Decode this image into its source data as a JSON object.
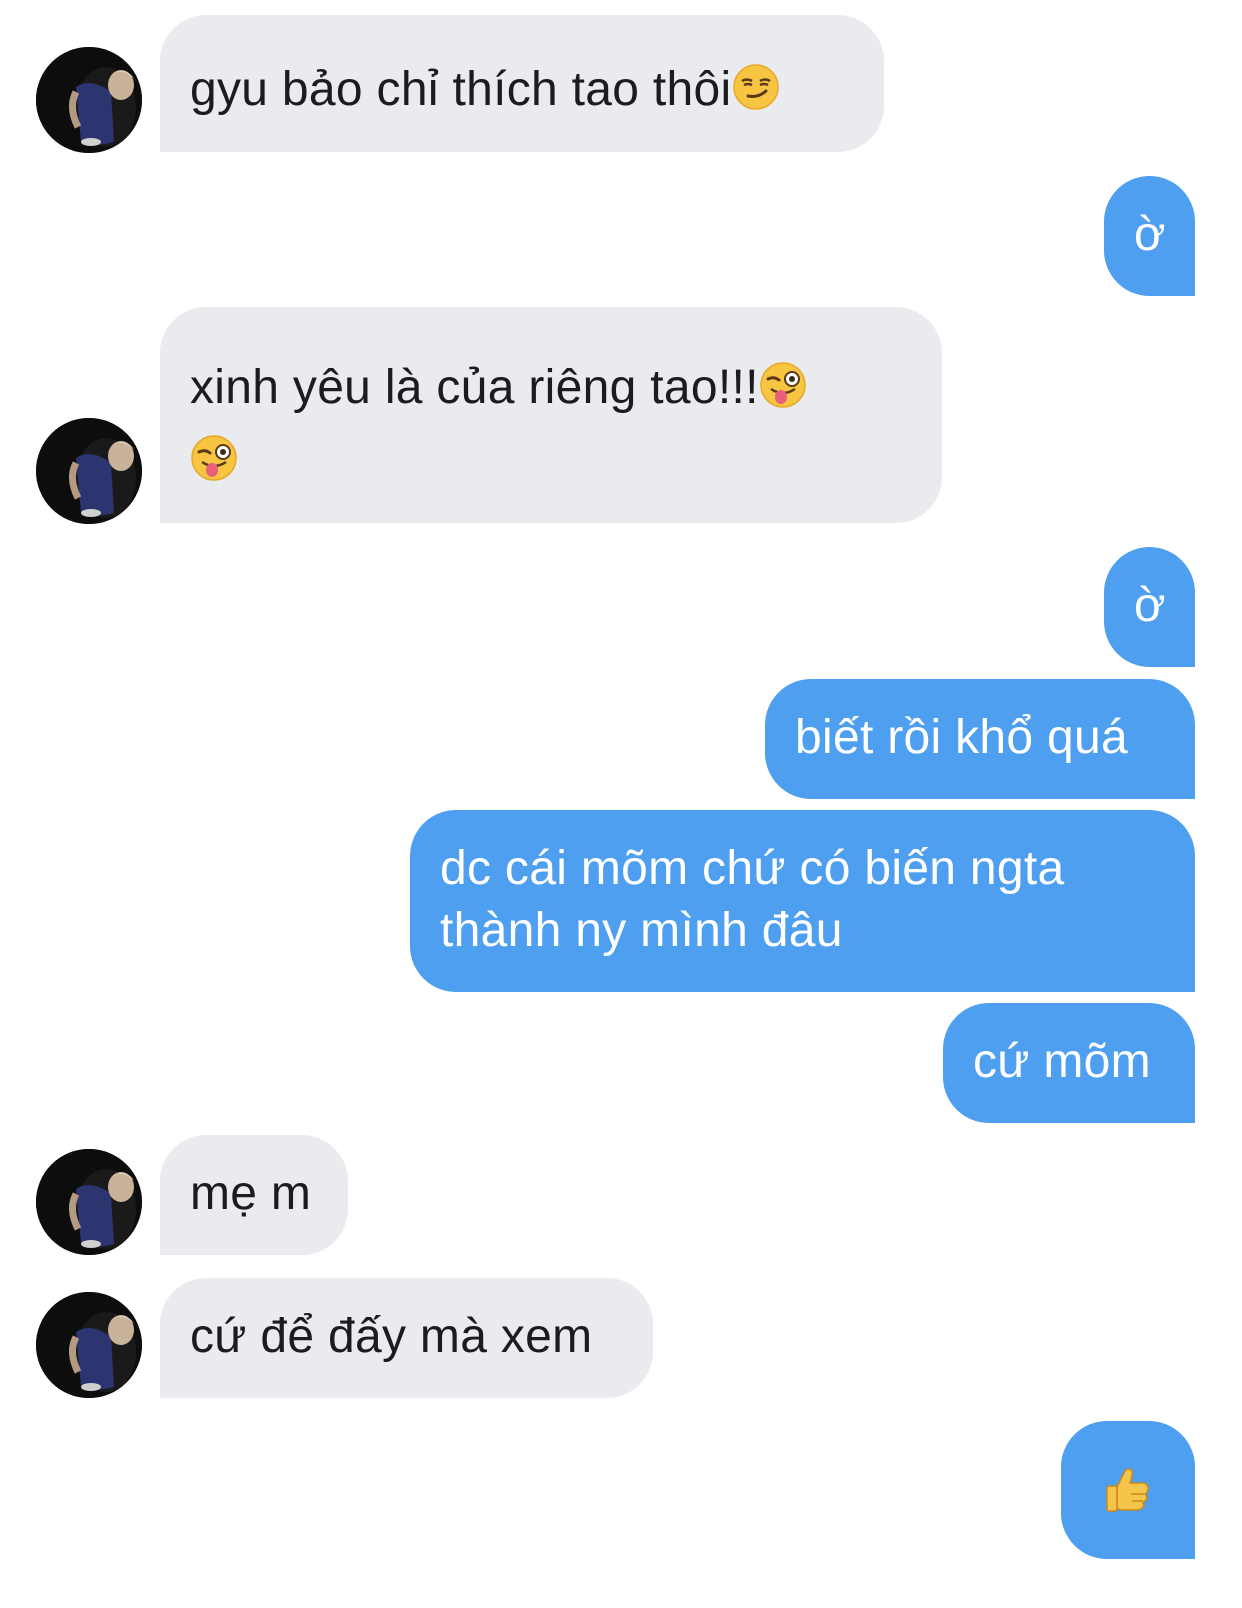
{
  "messages": [
    {
      "direction": "incoming",
      "text": "gyu bảo chỉ thích tao thôi",
      "emoji": "smirking-face"
    },
    {
      "direction": "outgoing",
      "text": "ờ"
    },
    {
      "direction": "incoming",
      "text": "xinh yêu là của riêng tao!!!",
      "emoji": "winking-face-with-tongue"
    },
    {
      "direction": "outgoing",
      "text": "ờ"
    },
    {
      "direction": "outgoing",
      "text": "biết rồi khổ quá"
    },
    {
      "direction": "outgoing",
      "text_line1": "dc cái mõm chứ có biến ngta",
      "text_line2": "thành ny mình đâu"
    },
    {
      "direction": "outgoing",
      "text": "cứ mõm"
    },
    {
      "direction": "incoming",
      "text": "mẹ m"
    },
    {
      "direction": "incoming",
      "text": "cứ để đấy mà xem"
    },
    {
      "direction": "outgoing",
      "emoji": "thumbs-up"
    }
  ],
  "colors": {
    "incoming_bubble": "#e9ebef",
    "outgoing_bubble": "#4e9ff0",
    "incoming_text": "#1c1c1e",
    "outgoing_text": "#ffffff"
  }
}
